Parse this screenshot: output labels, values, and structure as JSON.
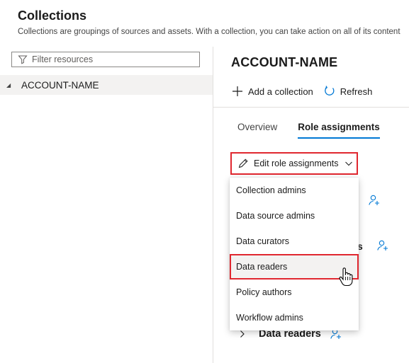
{
  "header": {
    "title": "Collections",
    "subtitle": "Collections are groupings of sources and assets. With a collection, you can take action on all of its content"
  },
  "left_pane": {
    "filter_placeholder": "Filter resources",
    "tree_root": "ACCOUNT-NAME"
  },
  "right_pane": {
    "title": "ACCOUNT-NAME",
    "toolbar": {
      "add_label": "Add a collection",
      "refresh_label": "Refresh"
    },
    "tabs": [
      {
        "label": "Overview",
        "active": false
      },
      {
        "label": "Role assignments",
        "active": true
      }
    ],
    "edit_button_label": "Edit role assignments",
    "background_text_fragment": "s",
    "section_label": "Data readers"
  },
  "dropdown": {
    "items": [
      "Collection admins",
      "Data source admins",
      "Data curators",
      "Data readers",
      "Policy authors",
      "Workflow admins"
    ],
    "hovered_item": "Data readers"
  },
  "colors": {
    "accent": "#0078d4",
    "highlight_border": "#e0272f",
    "selected_row_bg": "#f3f2f1"
  },
  "icons": [
    "filter-icon",
    "collapse-caret-icon",
    "plus-icon",
    "refresh-icon",
    "pencil-icon",
    "chevron-down-icon",
    "person-add-icon",
    "chevron-right-icon",
    "hand-pointer-cursor-icon"
  ]
}
